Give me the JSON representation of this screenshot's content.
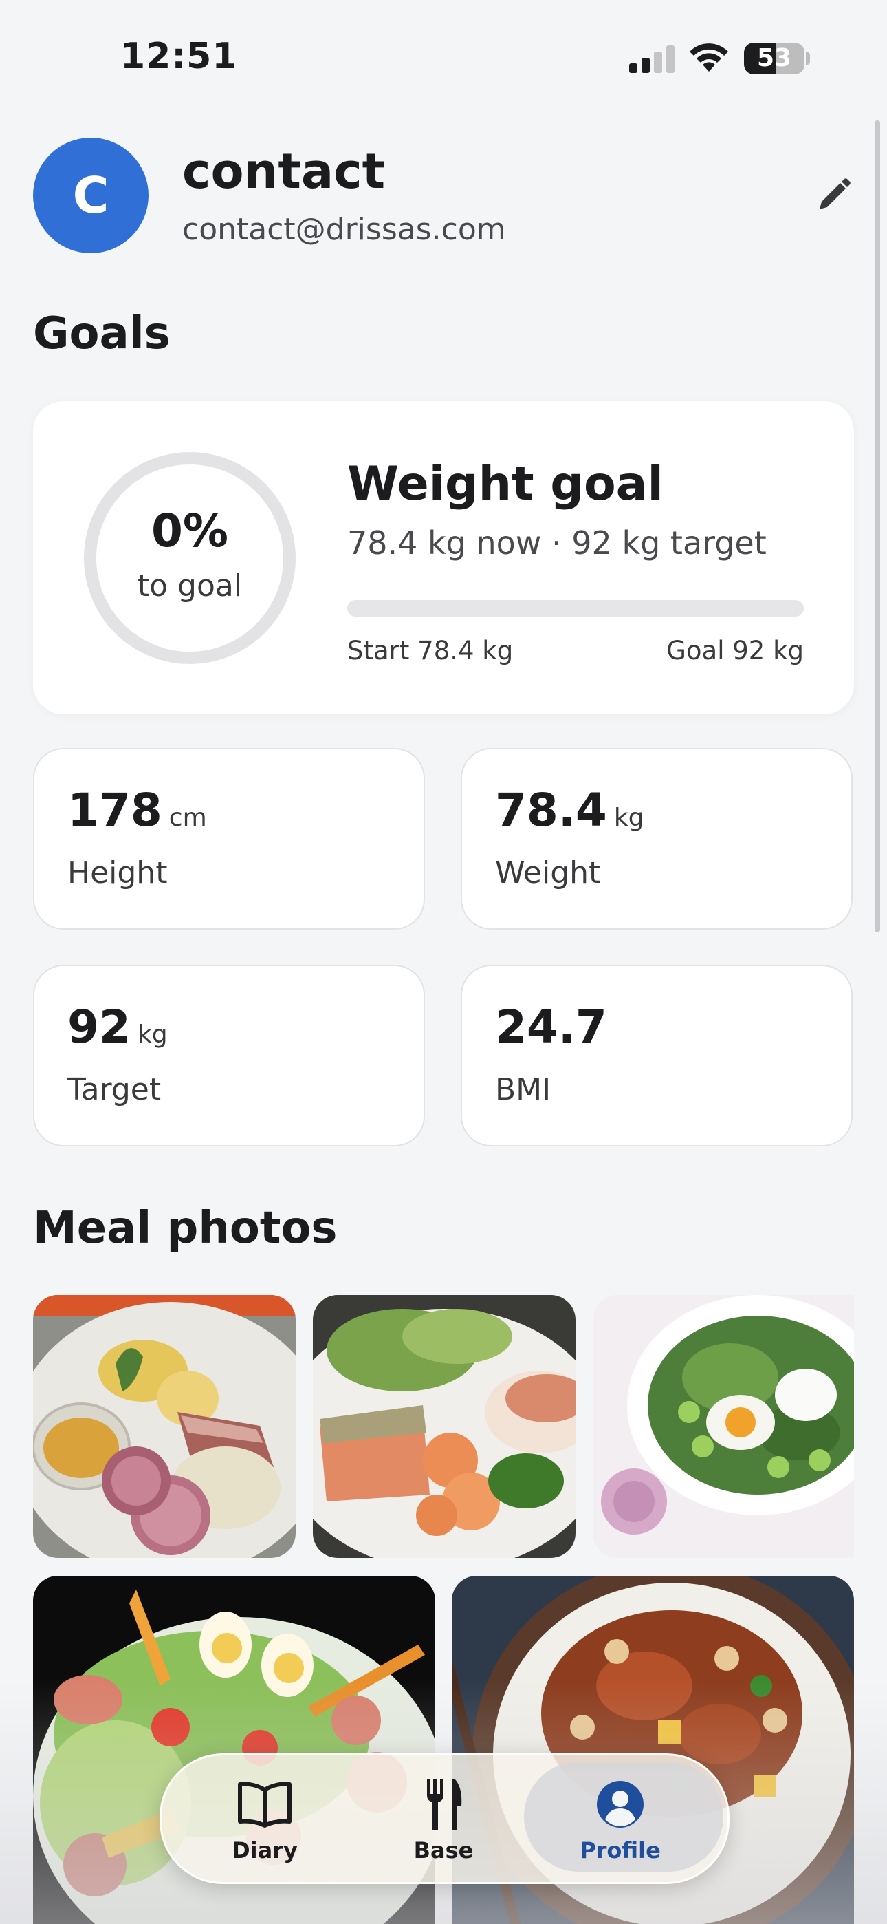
{
  "status_bar": {
    "time": "12:51",
    "battery_level": "53"
  },
  "profile": {
    "avatar_letter": "C",
    "name": "contact",
    "email": "contact@drissas.com"
  },
  "goals": {
    "section_title": "Goals",
    "weight_goal": {
      "percent_label": "0%",
      "percent_sub": "to goal",
      "progress_fraction": 0,
      "title": "Weight goal",
      "summary": "78.4 kg now · 92 kg target",
      "start_label": "Start 78.4 kg",
      "goal_label": "Goal 92 kg"
    },
    "stats": [
      {
        "value": "178",
        "unit": "cm",
        "label": "Height"
      },
      {
        "value": "78.4",
        "unit": "kg",
        "label": "Weight"
      },
      {
        "value": "92",
        "unit": "kg",
        "label": "Target"
      },
      {
        "value": "24.7",
        "unit": "",
        "label": "BMI"
      }
    ]
  },
  "meal_photos": {
    "section_title": "Meal photos"
  },
  "tab_bar": {
    "tabs": [
      {
        "label": "Diary",
        "icon": "book-icon",
        "active": false
      },
      {
        "label": "Base",
        "icon": "fork-knife-icon",
        "active": false
      },
      {
        "label": "Profile",
        "icon": "person-circle-icon",
        "active": true
      }
    ]
  },
  "colors": {
    "accent": "#2f6fd6",
    "background": "#f4f5f7",
    "active_tab": "#1f4e9c"
  }
}
